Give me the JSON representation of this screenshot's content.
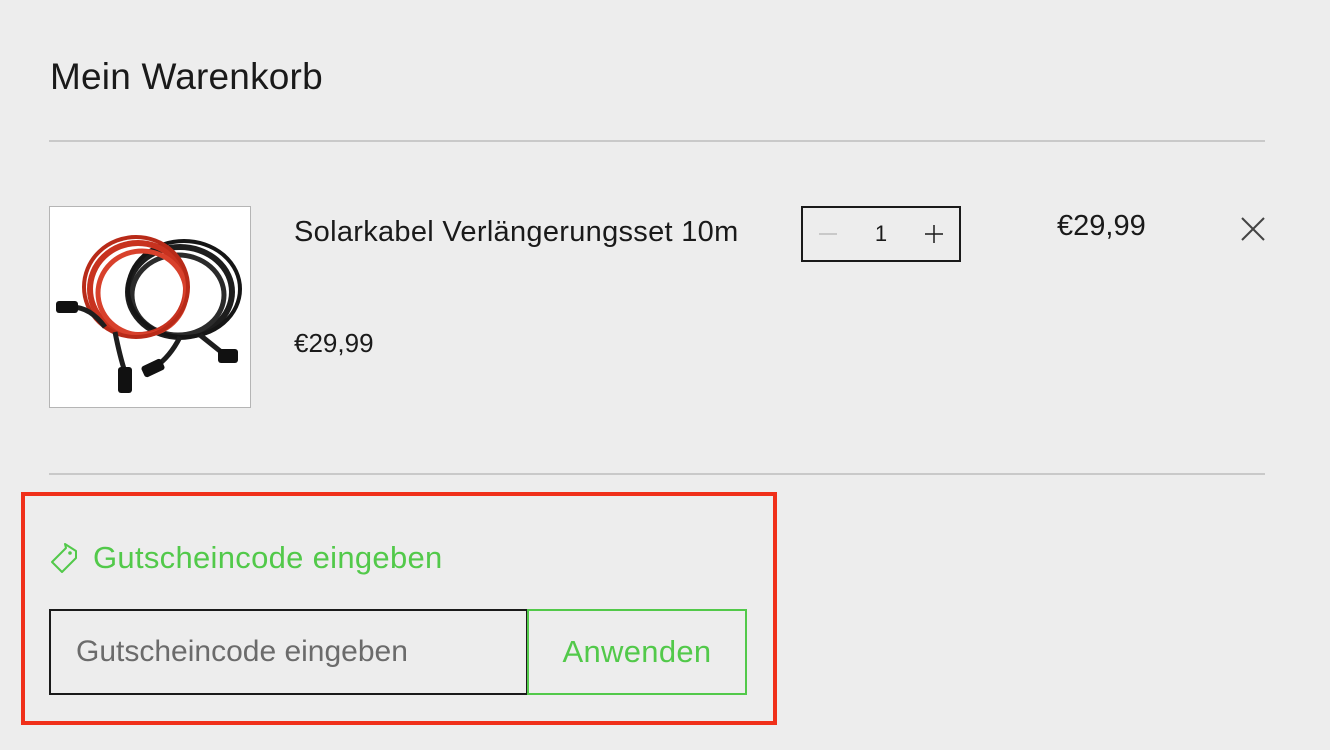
{
  "cart": {
    "title": "Mein Warenkorb"
  },
  "item": {
    "name": "Solarkabel Verlängerungsset 10m",
    "unit_price": "€29,99",
    "quantity": "1",
    "line_total": "€29,99",
    "image_icon": "solar-cable-photo"
  },
  "coupon": {
    "toggle_label": "Gutscheincode eingeben",
    "input_placeholder": "Gutscheincode eingeben",
    "input_value": "",
    "apply_label": "Anwenden"
  },
  "colors": {
    "accent_green": "#52c94a",
    "highlight_red": "#f0301a",
    "background": "#ededed"
  }
}
